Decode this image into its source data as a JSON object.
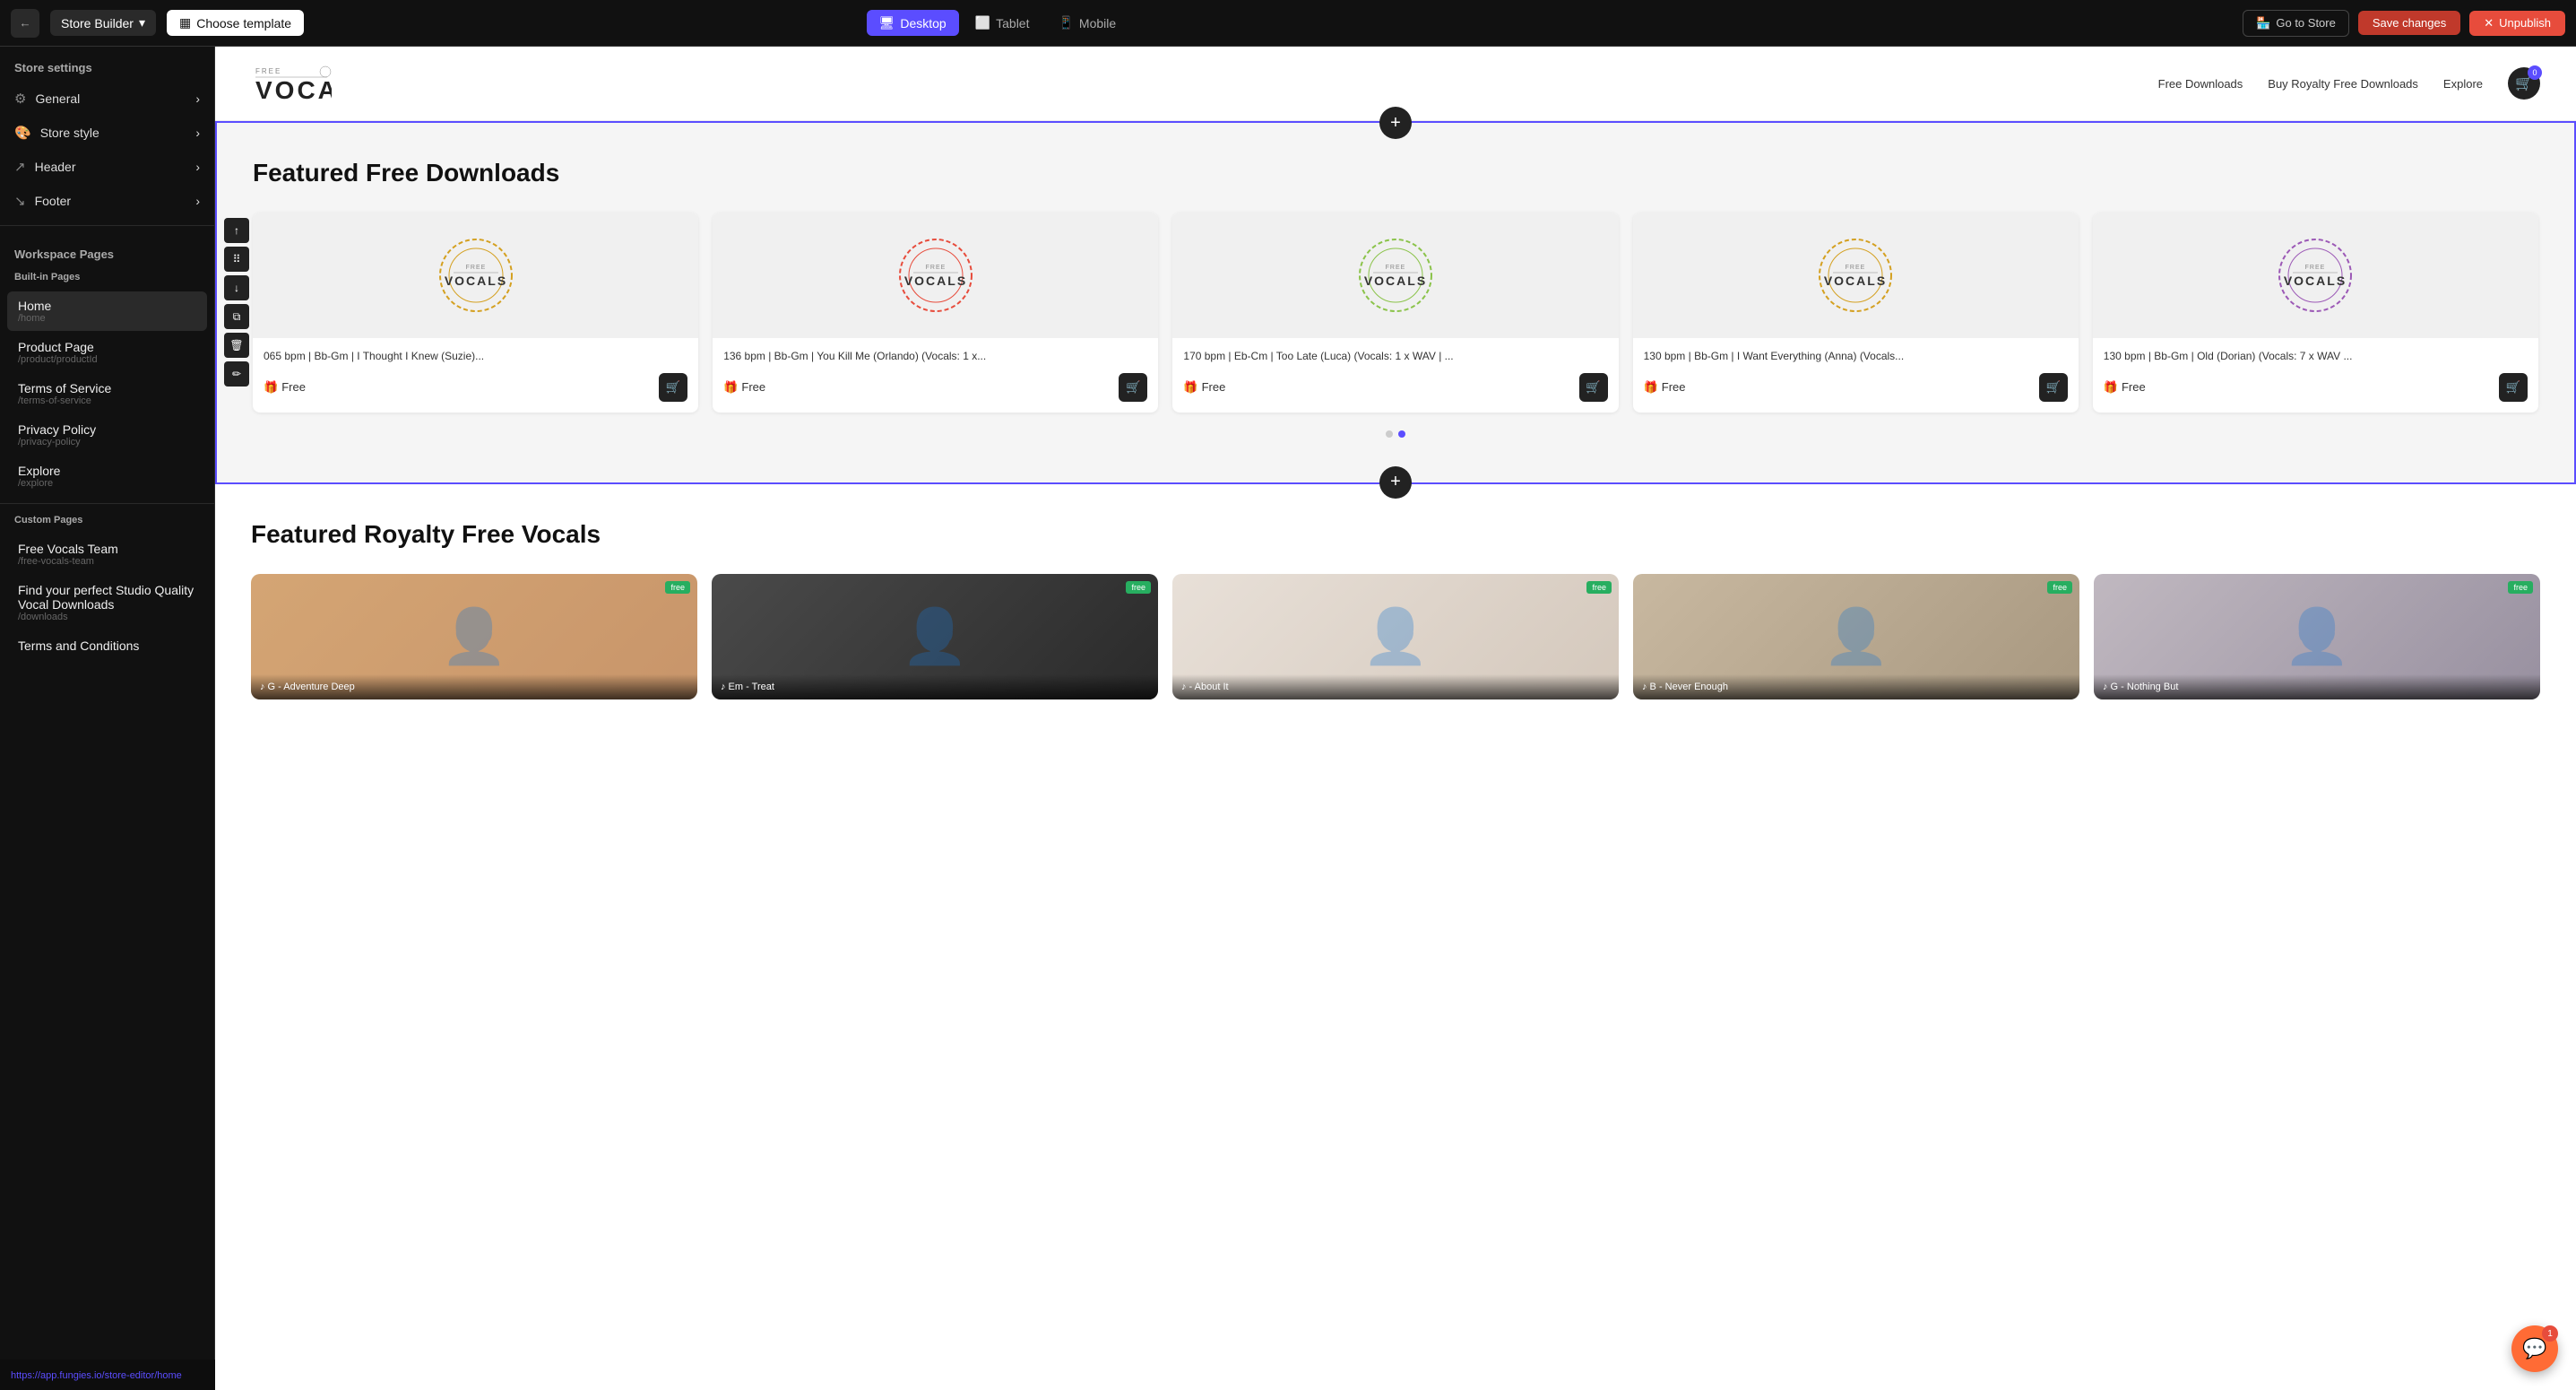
{
  "topbar": {
    "back_icon": "←",
    "store_builder_label": "Store Builder",
    "chevron_icon": "▾",
    "choose_template_label": "Choose template",
    "view_modes": [
      {
        "label": "Desktop",
        "icon": "🖥",
        "active": true
      },
      {
        "label": "Tablet",
        "icon": "⬜",
        "active": false
      },
      {
        "label": "Mobile",
        "icon": "📱",
        "active": false
      }
    ],
    "go_to_store_label": "Go to Store",
    "save_changes_label": "Save changes",
    "unpublish_label": "Unpublish",
    "unpublish_icon": "✕"
  },
  "sidebar": {
    "store_settings_title": "Store settings",
    "settings_items": [
      {
        "label": "General",
        "icon": "⚙"
      },
      {
        "label": "Store style",
        "icon": "🎨"
      },
      {
        "label": "Header",
        "icon": "↗"
      },
      {
        "label": "Footer",
        "icon": "↘"
      }
    ],
    "workspace_pages_title": "Workspace Pages",
    "built_in_pages_title": "Built-in Pages",
    "built_in_pages": [
      {
        "name": "Home",
        "path": "/home",
        "active": true
      },
      {
        "name": "Product Page",
        "path": "/product/productId",
        "active": false
      },
      {
        "name": "Terms of Service",
        "path": "/terms-of-service",
        "active": false
      },
      {
        "name": "Privacy Policy",
        "path": "/privacy-policy",
        "active": false
      },
      {
        "name": "Explore",
        "path": "/explore",
        "active": false
      }
    ],
    "custom_pages_title": "Custom Pages",
    "custom_pages": [
      {
        "name": "Free Vocals Team",
        "path": "/free-vocals-team",
        "active": false
      },
      {
        "name": "Find your perfect Studio Quality Vocal Downloads",
        "path": "/downloads",
        "active": false
      },
      {
        "name": "Terms and Conditions",
        "path": "",
        "active": false
      }
    ],
    "url_bar": "https://app.fungies.io/store-editor/home"
  },
  "store": {
    "logo_top": "FREE",
    "logo_main": "VOCALS",
    "nav_links": [
      "Free Downloads",
      "Buy Royalty Free Downloads",
      "Explore"
    ],
    "cart_count": "0"
  },
  "featured_section": {
    "title": "Featured Free Downloads",
    "products": [
      {
        "title": "065 bpm | Bb-Gm | I Thought I Knew (Suzie)...",
        "price": "Free",
        "ring_color": "#d4a020"
      },
      {
        "title": "136 bpm | Bb-Gm | You Kill Me (Orlando) (Vocals: 1 x...",
        "price": "Free",
        "ring_color": "#e74c3c"
      },
      {
        "title": "170 bpm | Eb-Cm | Too Late (Luca) (Vocals: 1 x WAV | ...",
        "price": "Free",
        "ring_color": "#8bc34a"
      },
      {
        "title": "130 bpm | Bb-Gm | I Want Everything (Anna) (Vocals...",
        "price": "Free",
        "ring_color": "#d4a020"
      },
      {
        "title": "130 bpm | Bb-Gm | Old (Dorian) (Vocals: 7 x WAV ...",
        "price": "Free",
        "ring_color": "#9c59b6"
      }
    ]
  },
  "royalty_section": {
    "title": "Featured Royalty Free Vocals",
    "cards": [
      {
        "label": "♪ G - Adventure Deep",
        "tag": "free"
      },
      {
        "label": "♪ Em - Treat",
        "tag": "free"
      },
      {
        "label": "♪ - About It",
        "tag": "free"
      },
      {
        "label": "♪ B - Never Enough",
        "tag": "free"
      },
      {
        "label": "♪ G - Nothing But",
        "tag": "free"
      }
    ]
  },
  "terms_url": "https://app.fungies.io/store-editor/home",
  "chat_badge": "1",
  "icons": {
    "back": "←",
    "chevron_right": "›",
    "chevron_down": "▾",
    "plus": "+",
    "up_arrow": "↑",
    "down_arrow": "↓",
    "move": "⠿",
    "copy": "⧉",
    "delete": "🗑",
    "edit": "✏",
    "cart": "🛒",
    "gift": "🎁",
    "store": "🏪",
    "chat": "💬"
  }
}
